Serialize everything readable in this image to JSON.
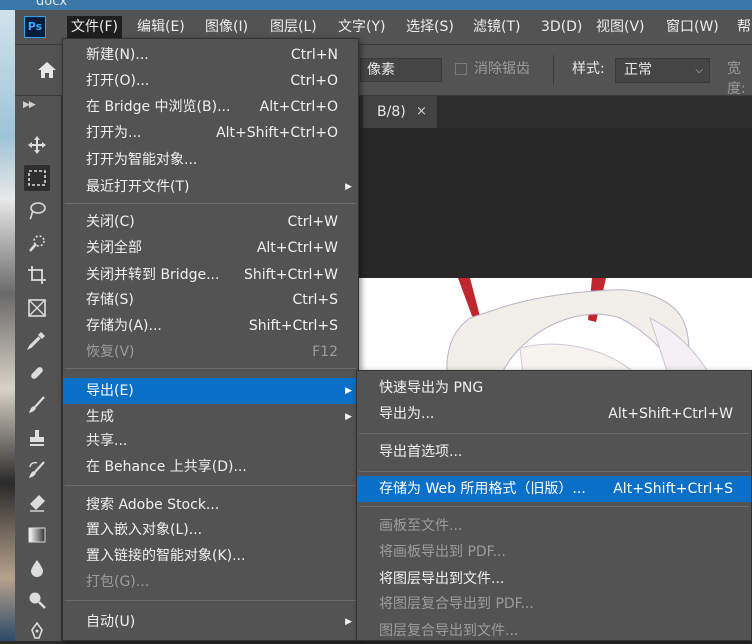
{
  "desktop": {
    "doc_label": "docx"
  },
  "app": {
    "logo": "Ps"
  },
  "menubar": [
    {
      "label": "文件(F)",
      "active": true
    },
    {
      "label": "编辑(E)"
    },
    {
      "label": "图像(I)"
    },
    {
      "label": "图层(L)"
    },
    {
      "label": "文字(Y)"
    },
    {
      "label": "选择(S)"
    },
    {
      "label": "滤镜(T)"
    },
    {
      "label": "3D(D)"
    },
    {
      "label": "视图(V)"
    },
    {
      "label": "窗口(W)"
    },
    {
      "label": "帮"
    }
  ],
  "options": {
    "unit_value": "像素",
    "antialias_label": "消除锯齿",
    "style_label": "样式:",
    "style_value": "正常",
    "width_label": "宽度:"
  },
  "tab": {
    "label": "B/8)",
    "close": "×"
  },
  "file_menu": {
    "items": [
      {
        "label": "新建(N)...",
        "shortcut": "Ctrl+N"
      },
      {
        "label": "打开(O)...",
        "shortcut": "Ctrl+O"
      },
      {
        "label": "在 Bridge 中浏览(B)...",
        "shortcut": "Alt+Ctrl+O"
      },
      {
        "label": "打开为...",
        "shortcut": "Alt+Shift+Ctrl+O"
      },
      {
        "label": "打开为智能对象..."
      },
      {
        "label": "最近打开文件(T)",
        "submenu": true
      },
      {
        "label": "关闭(C)",
        "shortcut": "Ctrl+W"
      },
      {
        "label": "关闭全部",
        "shortcut": "Alt+Ctrl+W"
      },
      {
        "label": "关闭并转到 Bridge...",
        "shortcut": "Shift+Ctrl+W"
      },
      {
        "label": "存储(S)",
        "shortcut": "Ctrl+S"
      },
      {
        "label": "存储为(A)...",
        "shortcut": "Shift+Ctrl+S"
      },
      {
        "label": "恢复(V)",
        "shortcut": "F12",
        "disabled": true
      },
      {
        "label": "导出(E)",
        "submenu": true,
        "highlighted": true
      },
      {
        "label": "生成",
        "submenu": true
      },
      {
        "label": "共享..."
      },
      {
        "label": "在 Behance 上共享(D)..."
      },
      {
        "label": "搜索 Adobe Stock..."
      },
      {
        "label": "置入嵌入对象(L)..."
      },
      {
        "label": "置入链接的智能对象(K)..."
      },
      {
        "label": "打包(G)...",
        "disabled": true
      },
      {
        "label": "自动(U)",
        "submenu": true
      }
    ]
  },
  "export_menu": {
    "items": [
      {
        "label": "快速导出为 PNG"
      },
      {
        "label": "导出为...",
        "shortcut": "Alt+Shift+Ctrl+W"
      },
      {
        "label": "导出首选项..."
      },
      {
        "label": "存储为 Web 所用格式（旧版）...",
        "shortcut": "Alt+Shift+Ctrl+S",
        "highlighted": true
      },
      {
        "label": "画板至文件...",
        "disabled": true
      },
      {
        "label": "将画板导出到 PDF...",
        "disabled": true
      },
      {
        "label": "将图层导出到文件..."
      },
      {
        "label": "将图层复合导出到 PDF...",
        "disabled": true
      },
      {
        "label": "图层复合导出到文件...",
        "disabled": true
      }
    ]
  }
}
